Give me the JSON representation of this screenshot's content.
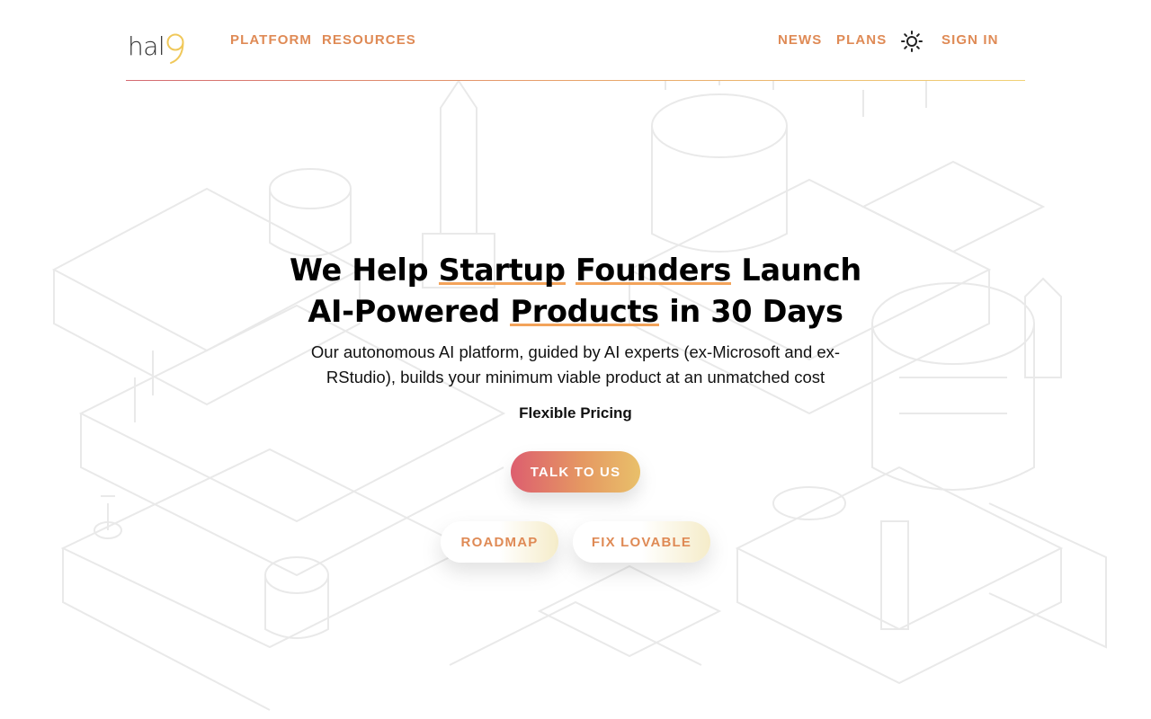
{
  "brand": {
    "logo_text": "hal",
    "logo_mark": "9",
    "logo_mark_color": "#f0c85a"
  },
  "nav": {
    "left": [
      "PLATFORM",
      "RESOURCES"
    ],
    "right": [
      "NEWS",
      "PLANS"
    ],
    "theme_icon": "sun-icon",
    "signin": "SIGN IN"
  },
  "hero": {
    "headline_parts": [
      "We Help ",
      "Startup",
      " ",
      "Founders",
      " Launch",
      "AI-Powered ",
      "Products",
      " in 30 Days"
    ],
    "subtitle": "Our autonomous AI platform, guided by AI experts (ex-Microsoft and ex-RStudio), builds your minimum viable product at an unmatched cost",
    "pricing": "Flexible Pricing",
    "cta_primary": "TALK TO US",
    "cta_secondary": [
      "ROADMAP",
      "FIX LOVABLE"
    ]
  },
  "colors": {
    "accent": "#df8a55",
    "underline": "#f3a35a",
    "gradient_start": "#dd5e6f",
    "gradient_end": "#e9c06a"
  }
}
